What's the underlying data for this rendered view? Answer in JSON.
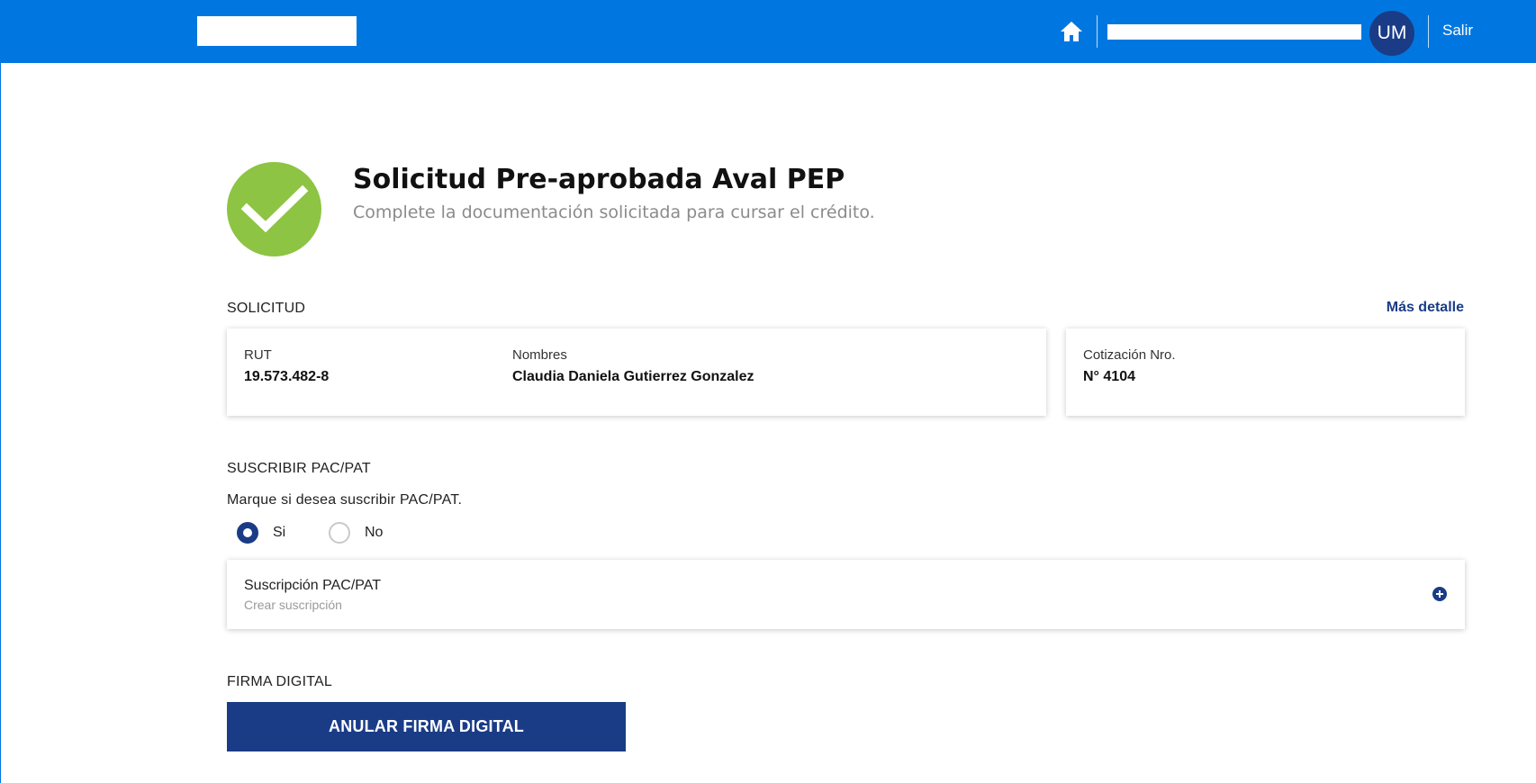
{
  "header": {
    "home_icon": "home-icon",
    "avatar_initials": "UM",
    "logout_label": "Salir",
    "bar_color": "#0077e0"
  },
  "heading": {
    "icon": "check-circle-icon",
    "title": "Solicitud Pre-aprobada Aval PEP",
    "subtitle": "Complete la documentación solicitada para cursar el crédito.",
    "icon_color": "#8dc443"
  },
  "solicitud": {
    "section_title": "SOLICITUD",
    "more_link": "Más detalle",
    "rut_label": "RUT",
    "rut_value": "19.573.482-8",
    "nombres_label": "Nombres",
    "nombres_value": "Claudia Daniela Gutierrez Gonzalez",
    "cotizacion_label": "Cotización Nro.",
    "cotizacion_value": "N° 4104"
  },
  "pac": {
    "section_title": "SUSCRIBIR PAC/PAT",
    "prompt": "Marque si desea suscribir PAC/PAT.",
    "options": [
      {
        "label": "Si",
        "checked": true
      },
      {
        "label": "No",
        "checked": false
      }
    ],
    "card_title": "Suscripción PAC/PAT",
    "card_subtitle": "Crear suscripción",
    "add_icon": "plus-circle-icon"
  },
  "firma": {
    "section_title": "FIRMA DIGITAL",
    "button_label": "ANULAR FIRMA DIGITAL",
    "button_color": "#1a3c86"
  }
}
